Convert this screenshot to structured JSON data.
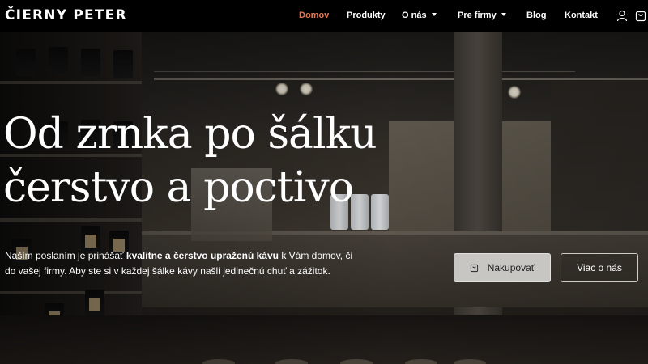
{
  "header": {
    "logo": "ČIERNY PETER",
    "nav": [
      {
        "label": "Domov",
        "active": true,
        "dropdown": false
      },
      {
        "label": "Produkty",
        "active": false,
        "dropdown": false
      },
      {
        "label": "O nás",
        "active": false,
        "dropdown": true
      },
      {
        "label": "Pre firmy",
        "active": false,
        "dropdown": true
      },
      {
        "label": "Blog",
        "active": false,
        "dropdown": false
      },
      {
        "label": "Kontakt",
        "active": false,
        "dropdown": false
      }
    ],
    "icons": {
      "account": "user-icon",
      "cart": "shopping-bag-icon"
    }
  },
  "hero": {
    "title_line1": "Od zrnka po šálku",
    "title_line2": "čerstvo a poctivo",
    "store_sign": "ČIERNY PETER",
    "text_part1": "Naším poslaním je prinášať ",
    "text_bold1": "kvalitne a čerstvo upraženú kávu",
    "text_part2": " k Vám domov, či do vašej firmy. Aby ste si v každej šálke kávy našli jedinečnú chuť a zážitok.",
    "shop_button": "Nakupovať",
    "more_button": "Viac o nás"
  },
  "colors": {
    "accent": "#e07a55",
    "header_bg": "#000000",
    "text": "#ffffff"
  }
}
